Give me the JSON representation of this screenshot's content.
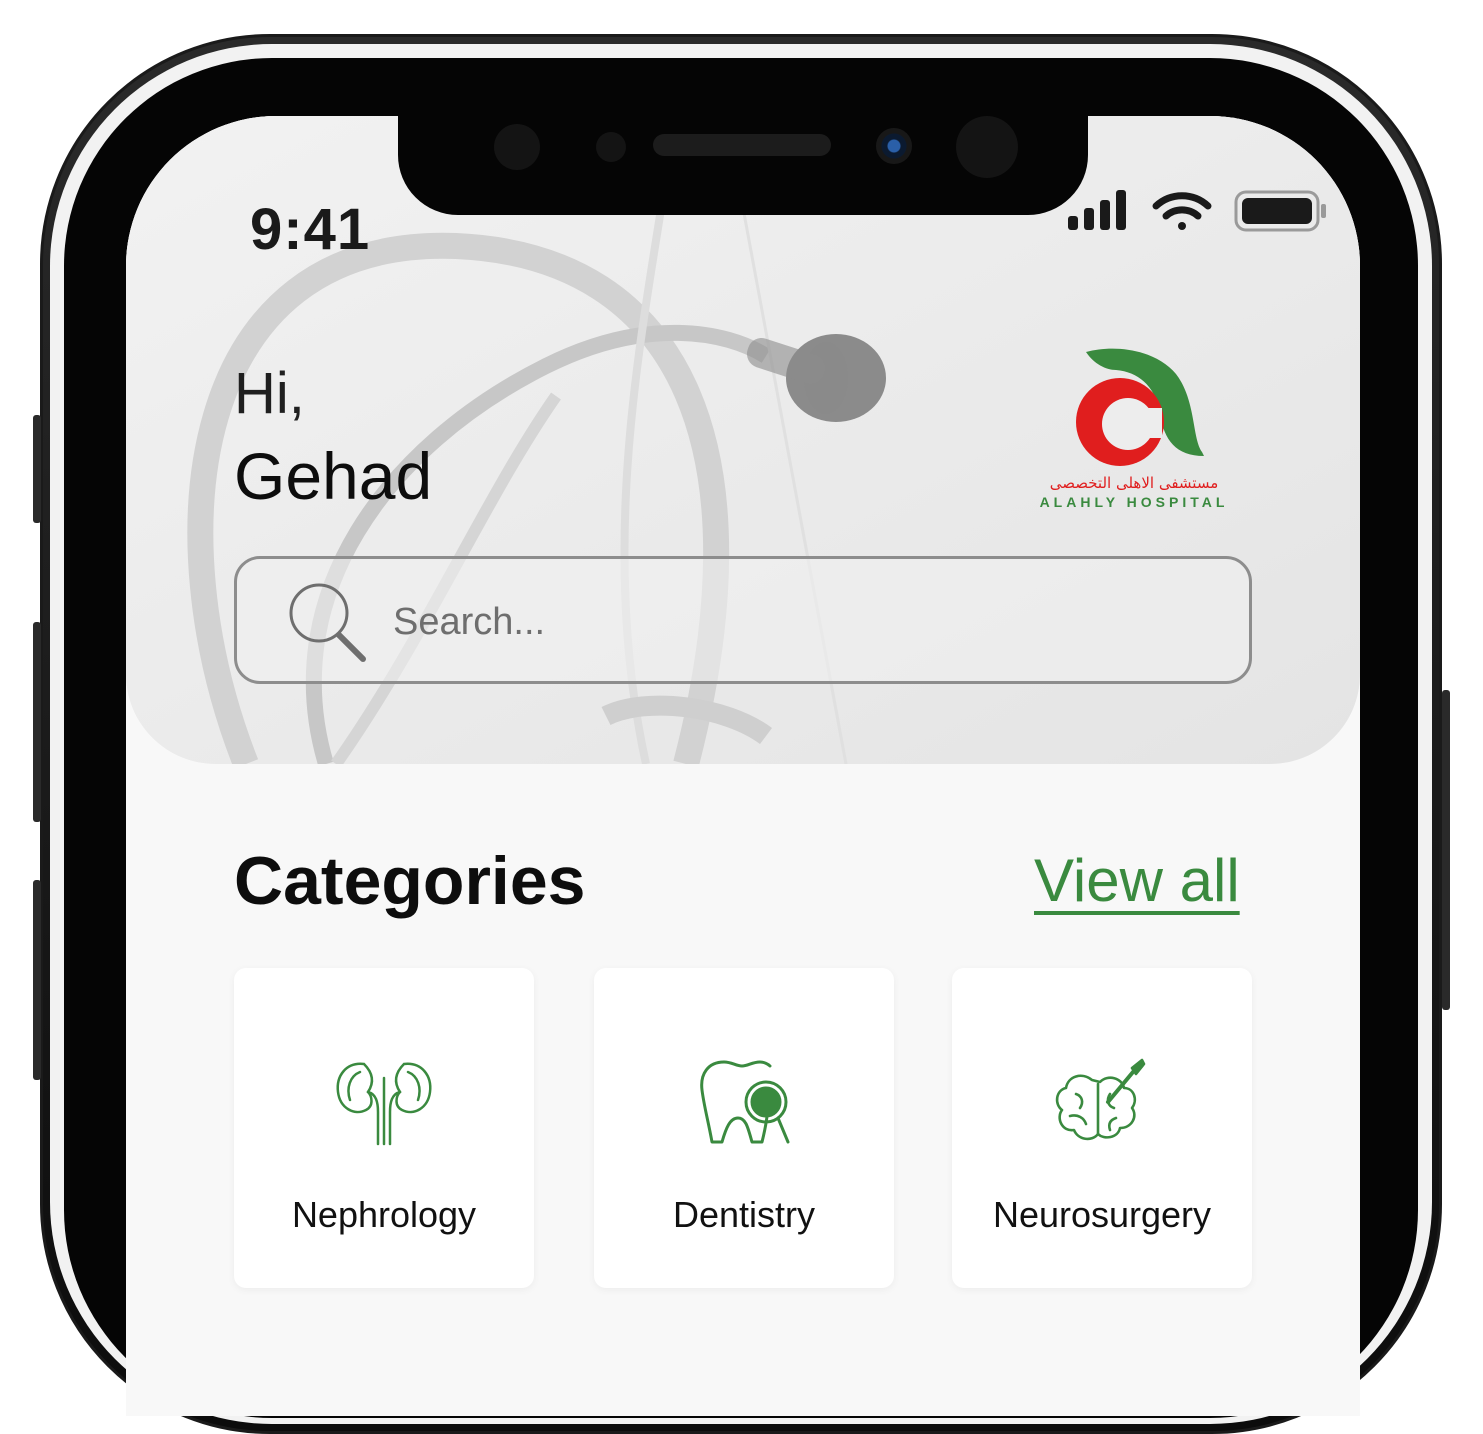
{
  "status_bar": {
    "time": "9:41"
  },
  "greeting": {
    "hi": "Hi,",
    "name": "Gehad"
  },
  "logo": {
    "arabic_text": "مستشفى الاهلى التخصصى",
    "english_text": "ALAHLY HOSPITAL"
  },
  "search": {
    "placeholder": "Search..."
  },
  "categories": {
    "title": "Categories",
    "view_all": "View all",
    "items": [
      {
        "label": "Nephrology",
        "icon": "kidneys-icon"
      },
      {
        "label": "Dentistry",
        "icon": "tooth-icon"
      },
      {
        "label": "Neurosurgery",
        "icon": "brain-icon"
      }
    ]
  },
  "colors": {
    "accent_green": "#3a8a3f",
    "logo_red": "#e01e1e"
  }
}
